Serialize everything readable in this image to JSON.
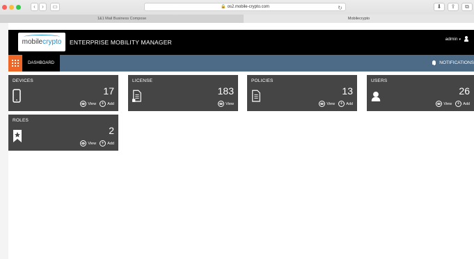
{
  "browser": {
    "url": "os2.mobile-crypto.com",
    "tabs": [
      {
        "label": "1&1 Mail Business Compose"
      },
      {
        "label": "Mobilecrypto"
      }
    ]
  },
  "header": {
    "logo_text_plain": "mobile",
    "logo_text_accent": "crypto",
    "app_title": "ENTERPRISE MOBILITY MANAGER",
    "user_label": "admin"
  },
  "nav": {
    "dashboard_label": "DASHBOARD",
    "notifications_label": "NOTIFICATIONS"
  },
  "tiles": [
    {
      "title": "DEVICES",
      "count": "17",
      "view_label": "View",
      "add_label": "Add",
      "icon": "mobile-device-icon"
    },
    {
      "title": "LICENSE",
      "count": "183",
      "view_label": "View",
      "icon": "license-document-icon"
    },
    {
      "title": "POLICIES",
      "count": "13",
      "view_label": "View",
      "add_label": "Add",
      "icon": "policy-document-icon"
    },
    {
      "title": "USERS",
      "count": "26",
      "view_label": "View",
      "add_label": "Add",
      "icon": "user-icon"
    },
    {
      "title": "ROLES",
      "count": "2",
      "view_label": "View",
      "add_label": "Add",
      "icon": "bookmark-star-icon"
    }
  ],
  "colors": {
    "header_bg": "#000000",
    "nav_bg": "#4d6b86",
    "grid_button": "#ef6726",
    "tile_bg": "#454545",
    "logo_accent": "#1e8ec8"
  }
}
